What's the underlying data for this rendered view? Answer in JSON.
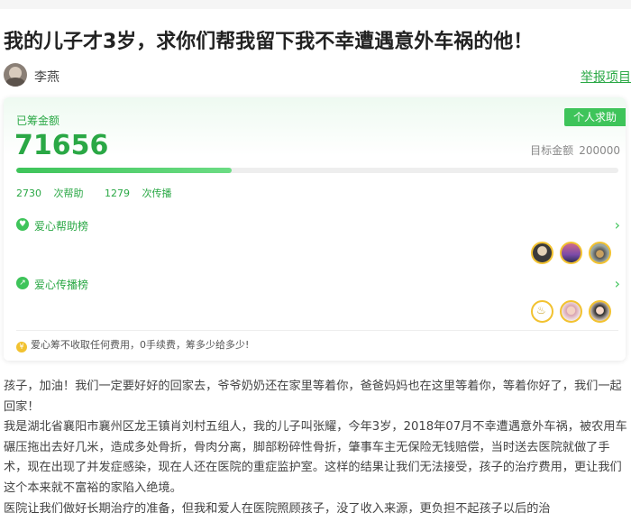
{
  "page": {
    "title": "我的儿子才3岁，求你们帮我留下我不幸遭遇意外车祸的他！"
  },
  "author": {
    "name": "李燕",
    "report_label": "举报项目"
  },
  "fundraising": {
    "raised_label": "已筹金额",
    "raised_amount": "71656",
    "badge": "个人求助",
    "target_label": "目标金额",
    "target_amount": "200000",
    "progress_fraction": 0.358,
    "help_count": "2730",
    "help_label": "次帮助",
    "share_count": "1279",
    "share_label": "次传播",
    "help_board_label": "爱心帮助榜",
    "spread_board_label": "爱心传播榜",
    "notice": "爱心筹不收取任何费用，0手续费，筹多少给多少!"
  },
  "icons": {
    "help_board": "heart-shield-icon",
    "spread_board": "share-arrow-icon",
    "notice": "yuan-coin-icon",
    "chevron": "chevron-right-icon"
  },
  "colors": {
    "accent": "#2aa845",
    "badge_bg": "#3ec45a",
    "avatar_ring": "#f2c230"
  },
  "story": {
    "paragraphs": [
      "孩子，加油！我们一定要好好的回家去，爷爷奶奶还在家里等着你，爸爸妈妈也在这里等着你，等着你好了，我们一起回家！",
      "我是湖北省襄阳市襄州区龙王镇肖刘村五组人，我的儿子叫张耀，今年3岁，2018年07月不幸遭遇意外车祸，被农用车碾压拖出去好几米，造成多处骨折，骨肉分离，脚部粉碎性骨折，肇事车主无保险无钱赔偿，当时送去医院就做了手术，现在出现了并发症感染，现在人还在医院的重症监护室。这样的结果让我们无法接受，孩子的治疗费用，更让我们这个本来就不富裕的家陷入绝境。",
      "医院让我们做好长期治疗的准备，但我和爱人在医院照顾孩子，没了收入来源，更负担不起孩子以后的治"
    ]
  }
}
